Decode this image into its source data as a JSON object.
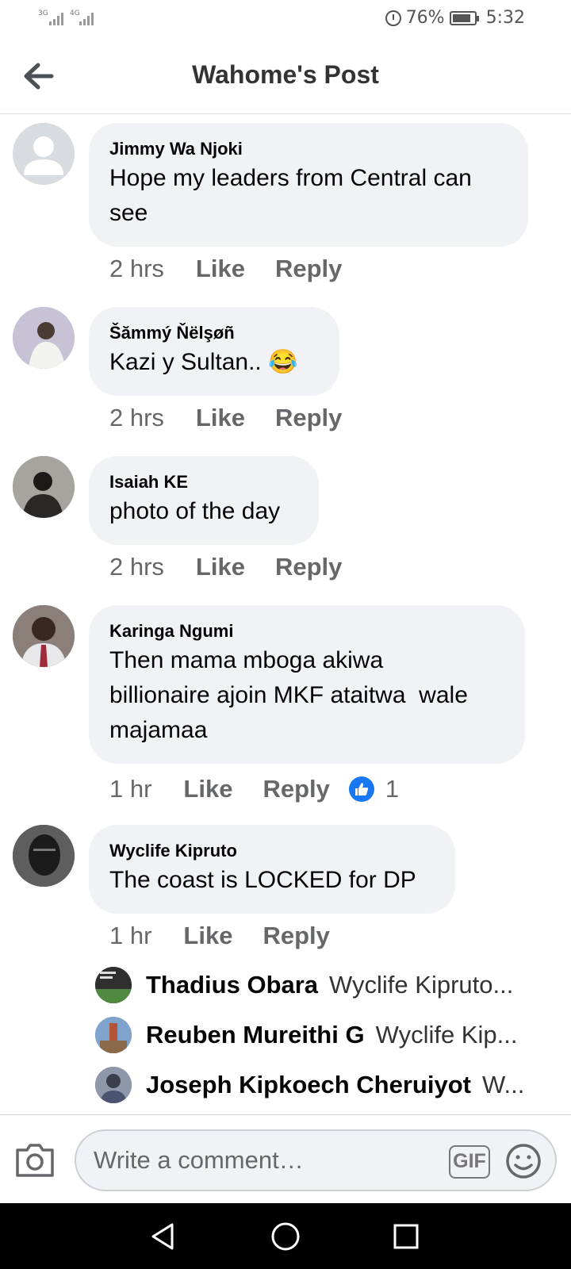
{
  "status_bar": {
    "signal1_label": "3G",
    "signal2_label": "4G",
    "battery_percent": "76%",
    "time": "5:32"
  },
  "header": {
    "title": "Wahome's Post",
    "back_icon": "arrow-left-icon"
  },
  "comments": [
    {
      "author": "Jimmy Wa Njoki",
      "lines": [
        "Hope my leaders from Central can",
        "see"
      ],
      "time": "2 hrs",
      "like_label": "Like",
      "reply_label": "Reply"
    },
    {
      "author": "Šămmý Ňëlşøñ",
      "lines": [
        "Kazi y Sultan.. 😂"
      ],
      "time": "2 hrs",
      "like_label": "Like",
      "reply_label": "Reply"
    },
    {
      "author": "Isaiah KE",
      "lines": [
        "photo of the day"
      ],
      "time": "2 hrs",
      "like_label": "Like",
      "reply_label": "Reply"
    },
    {
      "author": "Karinga Ngumi",
      "lines": [
        "Then mama mboga akiwa",
        "billionaire ajoin MKF ataitwa  wale",
        "majamaa"
      ],
      "time": "1 hr",
      "like_label": "Like",
      "reply_label": "Reply",
      "reaction_count": "1"
    },
    {
      "author": "Wyclife Kipruto",
      "lines": [
        "The coast is LOCKED for DP"
      ],
      "time": "1 hr",
      "like_label": "Like",
      "reply_label": "Reply"
    }
  ],
  "replies": [
    {
      "author": "Thadius Obara",
      "preview": "Wyclife Kipruto..."
    },
    {
      "author": "Reuben Mureithi G",
      "preview": "Wyclife Kip..."
    },
    {
      "author": "Joseph Kipkoech Cheruiyot",
      "preview": "W..."
    }
  ],
  "composer": {
    "placeholder": "Write a comment…",
    "gif_label": "GIF"
  }
}
